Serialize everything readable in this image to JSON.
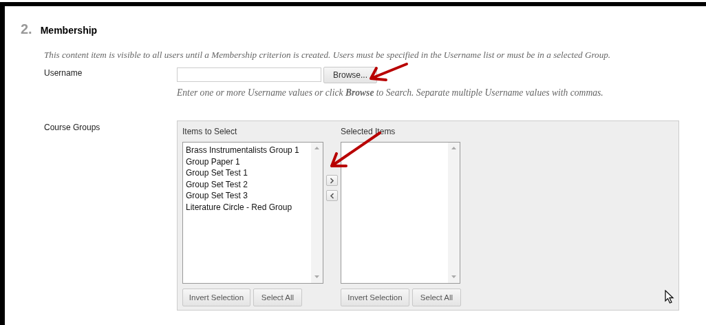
{
  "section": {
    "number": "2.",
    "title": "Membership",
    "description": "This content item is visible to all users until a Membership criterion is created. Users must be specified in the Username list or must be in a selected Group."
  },
  "username": {
    "label": "Username",
    "button": "Browse...",
    "hint": "Enter one or more Username values or click **Browse** to Search. Separate multiple Username values with commas."
  },
  "course_groups": {
    "label": "Course Groups",
    "available": {
      "title": "Items to Select",
      "items": [
        "Brass Instrumentalists Group 1",
        "Group Paper 1",
        "Group Set Test 1",
        "Group Set Test 2",
        "Group Set Test 3",
        "Literature Circle - Red Group"
      ],
      "buttons": [
        "Invert Selection",
        "Select All"
      ]
    },
    "chosen": {
      "title": "Selected Items",
      "buttons": [
        "Invert Selection",
        "Select All"
      ]
    }
  }
}
